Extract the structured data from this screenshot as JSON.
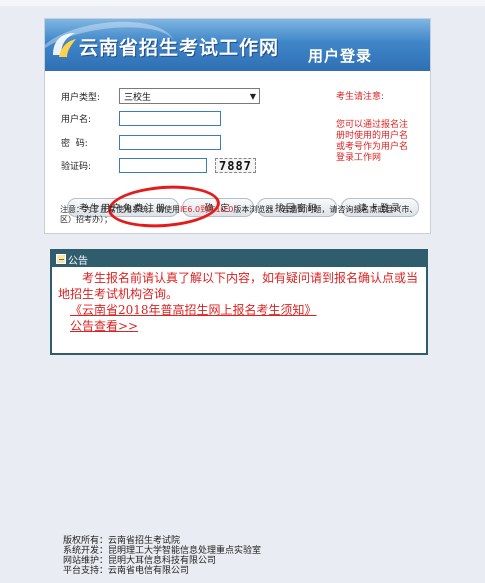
{
  "banner": {
    "title": "云南省招生考试工作网",
    "subtitle": "用户登录"
  },
  "form": {
    "user_type_label": "用户类型:",
    "user_type_value": "三校生",
    "username_label": "用户名:",
    "username_value": "",
    "password_label": "密  码:",
    "password_value": "",
    "captcha_label": "验证码:",
    "captcha_value": "",
    "captcha_code": "7887"
  },
  "notice": {
    "title": "考生请注意:",
    "body": "您可以通过报名注册时使用的用户名或考号作为用户名登录工作网"
  },
  "buttons": {
    "register": "考生用户免费注册",
    "confirm": "确 定",
    "find_password": "找回密码",
    "read_card": "读卡登录"
  },
  "tip": {
    "prefix": "注意：为了正常使用系统，请使用",
    "browser": "IE6.0到IE10.0",
    "suffix": "版本浏览器（若遇到问题，请咨询报名点或县（市、区）招考办）；"
  },
  "announcement": {
    "header": "公告",
    "paragraph": "考生报名前请认真了解以下内容，如有疑问请到报名确认点或当地招生考试机构咨询。",
    "link1": "《云南省2018年普高招生网上报名考生须知》",
    "link2": "公告查看>>"
  },
  "footer": {
    "line1": "版权所有：云南省招生考试院",
    "line2": "系统开发：昆明理工大学智能信息处理重点实验室",
    "line3": "网站维护：昆明大耳信息科技有限公司",
    "line4": "平台支持：云南省电信有限公司"
  },
  "colors": {
    "accent_red": "#dd2222",
    "banner_blue": "#3f86c8",
    "announcement_bar": "#2f5d6e",
    "highlight_circle": "#e41b1b"
  }
}
